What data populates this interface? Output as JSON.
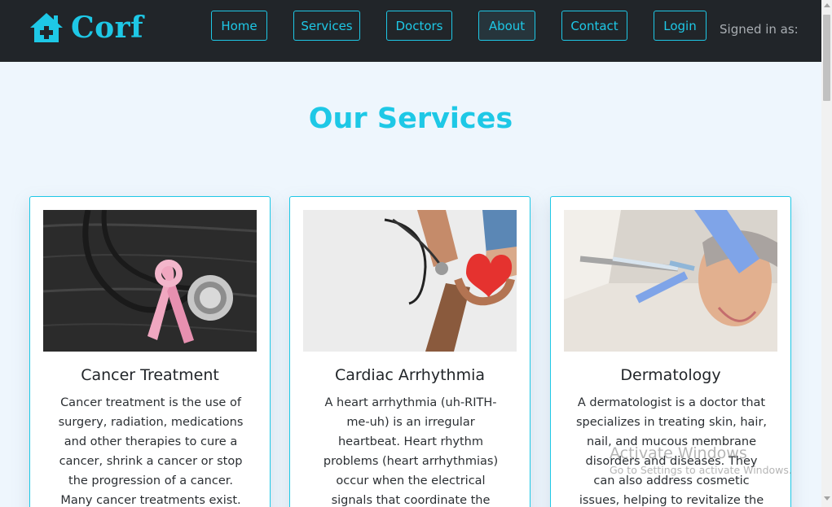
{
  "brand": {
    "name": "Corf",
    "icon": "house-medical-icon",
    "color": "#1ec8e6"
  },
  "nav": {
    "items": [
      {
        "label": "Home"
      },
      {
        "label": "Services"
      },
      {
        "label": "Doctors"
      },
      {
        "label": "About",
        "active": true
      },
      {
        "label": "Contact"
      },
      {
        "label": "Login"
      }
    ],
    "signed_in_label": "Signed in as:"
  },
  "section": {
    "title": "Our Services"
  },
  "cards": [
    {
      "title": "Cancer Treatment",
      "image": "stethoscope-pink-ribbon-photo",
      "text": "Cancer treatment is the use of surgery, radiation, medications and other therapies to cure a cancer, shrink a cancer or stop the progression of a cancer. Many cancer treatments exist."
    },
    {
      "title": "Cardiac Arrhythmia",
      "image": "hands-holding-heart-stethoscope-photo",
      "text": "A heart arrhythmia (uh-RITH-me-uh) is an irregular heartbeat. Heart rhythm problems (heart arrhythmias) occur when the electrical signals that coordinate the heart's beats don't work"
    },
    {
      "title": "Dermatology",
      "image": "dermatology-facial-treatment-photo",
      "text": "A dermatologist is a doctor that specializes in treating skin, hair, nail, and mucous membrane disorders and diseases. They can also address cosmetic issues, helping to revitalize the"
    }
  ],
  "watermark": {
    "line1": "Activate Windows",
    "line2": "Go to Settings to activate Windows."
  },
  "colors": {
    "navbar": "#212529",
    "accent": "#1ec8e6",
    "page_bg": "#eef6fd"
  }
}
